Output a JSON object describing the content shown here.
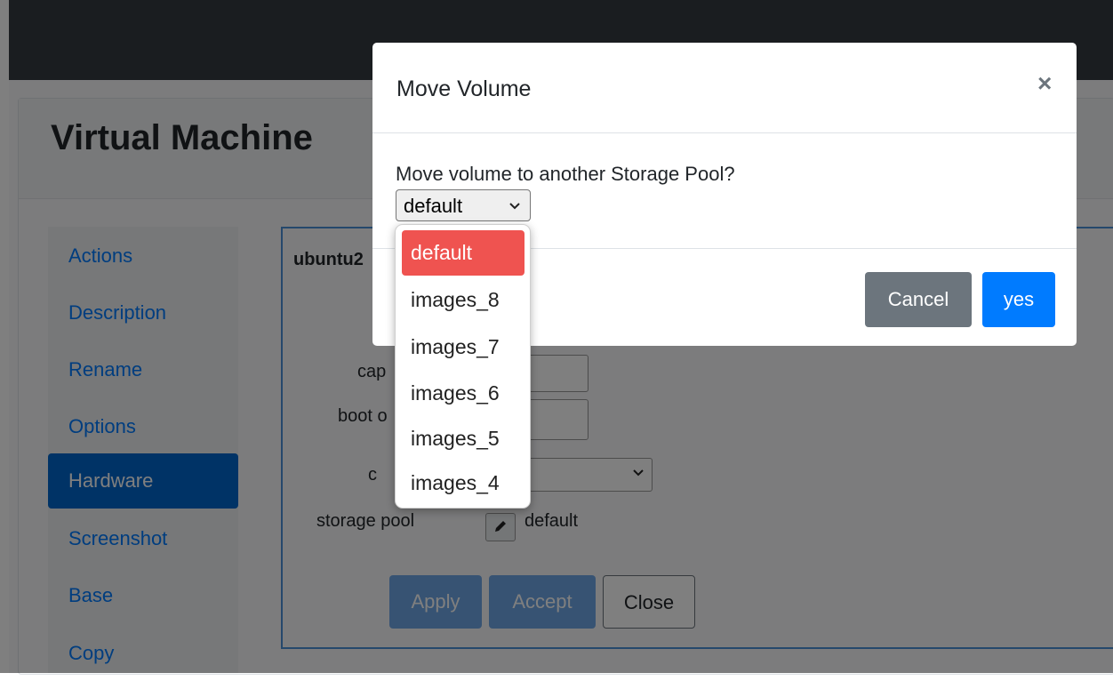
{
  "page": {
    "title": "Virtual Machine"
  },
  "sidebar": {
    "items": [
      {
        "label": "Actions",
        "active": false
      },
      {
        "label": "Description",
        "active": false
      },
      {
        "label": "Rename",
        "active": false
      },
      {
        "label": "Options",
        "active": false
      },
      {
        "label": "Hardware",
        "active": true
      },
      {
        "label": "Screenshot",
        "active": false
      },
      {
        "label": "Base",
        "active": false
      },
      {
        "label": "Copy",
        "active": false
      }
    ]
  },
  "panel": {
    "vm_name": "ubuntu2",
    "labels": {
      "capacity": "cap",
      "boot_order": "boot o",
      "cache": "c",
      "storage_pool": "storage pool"
    },
    "storage_pool_value": "default",
    "buttons": {
      "apply": "Apply",
      "accept": "Accept",
      "close": "Close"
    }
  },
  "modal": {
    "title": "Move Volume",
    "close_symbol": "×",
    "prompt": "Move volume to another Storage Pool?",
    "select_value": "default",
    "cancel_label": "Cancel",
    "confirm_label": "yes"
  },
  "dropdown": {
    "options": [
      "default",
      "images_8",
      "images_7",
      "images_6",
      "images_5",
      "images_4"
    ],
    "selected": "default"
  },
  "colors": {
    "topbar": "#343a40",
    "link": "#007bff",
    "active_nav": "#0066cc",
    "cancel": "#6c757d",
    "primary": "#007bff",
    "selected_option": "#ef5350"
  },
  "icons": {
    "close": "close-icon",
    "select_caret": "chevron-down-icon",
    "edit": "pencil-icon"
  }
}
